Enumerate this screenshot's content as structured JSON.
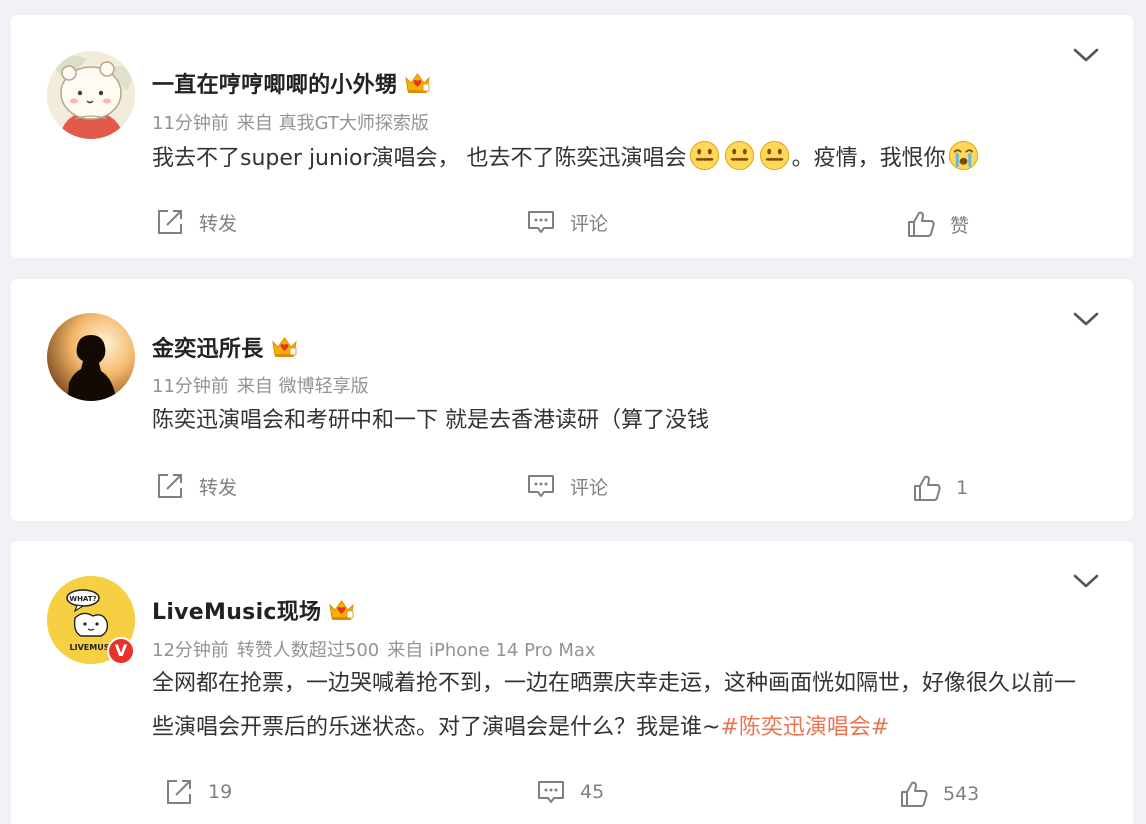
{
  "posts": [
    {
      "username": "一直在哼哼唧唧的小外甥",
      "time": "11分钟前",
      "repost_note": "",
      "source": "来自 真我GT大师探索版",
      "text_parts": [
        "我去不了super junior演唱会， 也去不了陈奕迅演唱会",
        "。疫情，我恨你"
      ],
      "repost_label": "转发",
      "comment_label": "评论",
      "like_label": "赞",
      "avatar_icon": "bear-avatar-icon",
      "emoji_icons": [
        "zipper-mouth-emoji",
        "zipper-mouth-emoji",
        "zipper-mouth-emoji",
        "crying-emoji"
      ]
    },
    {
      "username": "金奕迅所長",
      "time": "11分钟前",
      "repost_note": "",
      "source": "来自 微博轻享版",
      "text": "陈奕迅演唱会和考研中和一下 就是去香港读研（算了没钱",
      "repost_label": "转发",
      "comment_label": "评论",
      "like_label": "1",
      "avatar_icon": "silhouette-avatar-icon"
    },
    {
      "username": "LiveMusic现场",
      "time": "12分钟前",
      "repost_note": "转赞人数超过500",
      "source": "来自 iPhone 14 Pro Max",
      "text": "全网都在抢票，一边哭喊着抢不到，一边在晒票庆幸走运，这种画面恍如隔世，好像很久以前一些演唱会开票后的乐迷状态。对了演唱会是什么？我是谁~",
      "topic": "#陈奕迅演唱会#",
      "repost_label": "19",
      "comment_label": "45",
      "like_label": "543",
      "avatar_icon": "livemusic-logo-avatar-icon",
      "avatar_logo_top": "WHAT?",
      "avatar_logo_bottom": "LIVEMUSI",
      "verified_badge": "V"
    }
  ],
  "colors": {
    "background": "#f1f2f5",
    "card": "#ffffff",
    "meta_text": "#939393",
    "action_text": "#808080",
    "topic_link": "#eb7350",
    "verified_badge": "#e8322e",
    "crown_gold": "#f5b300"
  },
  "icons": {
    "member": "crown-icon",
    "menu": "chevron-down-icon",
    "repost": "share-icon",
    "comment": "comment-icon",
    "like": "thumbs-up-icon"
  }
}
